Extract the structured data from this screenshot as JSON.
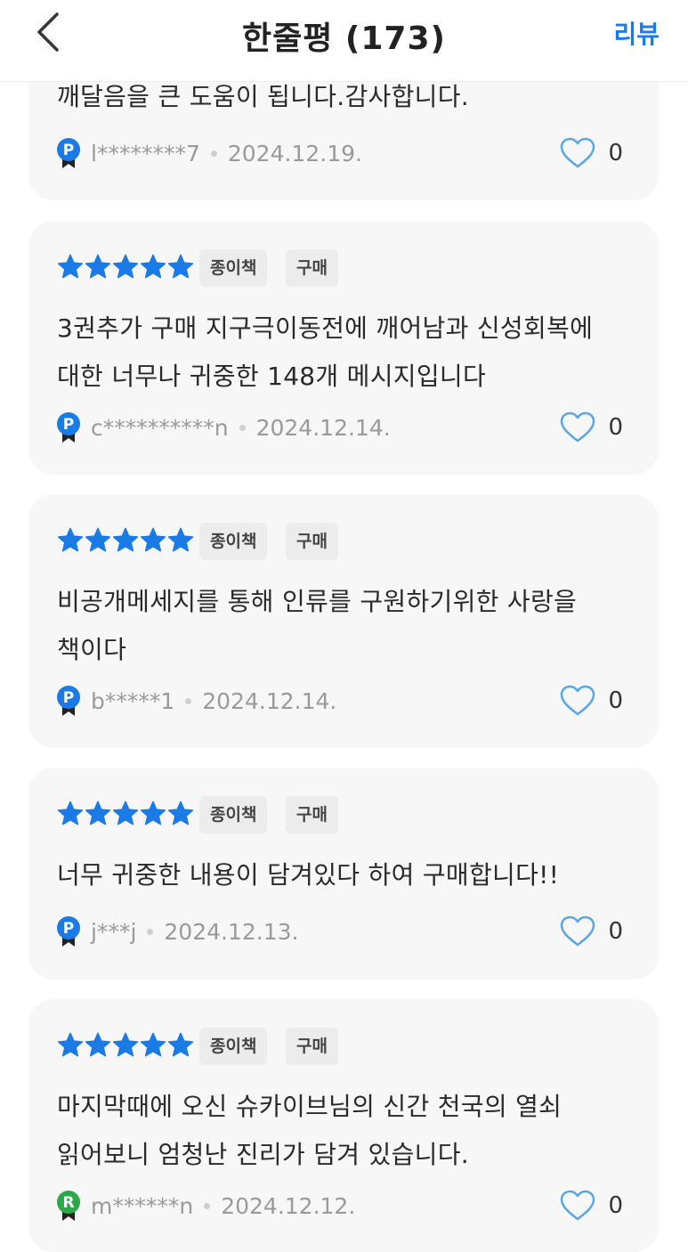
{
  "header": {
    "title": "한줄평 (173)",
    "review_link": "리뷰",
    "accent_color": "#1a7be6"
  },
  "reviews": [
    {
      "text": "깨달음을 큰 도움이 됩니다.감사합니다.",
      "user": "l********7",
      "date": "2024.12.19.",
      "likes": "0",
      "badge": "P"
    },
    {
      "rating": 5,
      "tags": [
        "종이책",
        "구매"
      ],
      "text": "3권추가 구매 지구극이동전에 깨어남과 신성회복에 대한 너무나 귀중한 148개 메시지입니다",
      "user": "c**********n",
      "date": "2024.12.14.",
      "likes": "0",
      "badge": "P"
    },
    {
      "rating": 5,
      "tags": [
        "종이책",
        "구매"
      ],
      "text": "비공개메세지를 통해 인류를 구원하기위한 사랑을 책이다",
      "user": "b*****1",
      "date": "2024.12.14.",
      "likes": "0",
      "badge": "P"
    },
    {
      "rating": 5,
      "tags": [
        "종이책",
        "구매"
      ],
      "text": "너무 귀중한 내용이 담겨있다 하여 구매합니다!!",
      "user": "j***j",
      "date": "2024.12.13.",
      "likes": "0",
      "badge": "P"
    },
    {
      "rating": 5,
      "tags": [
        "종이책",
        "구매"
      ],
      "text": "마지막때에 오신 슈카이브님의 신간 천국의 열쇠 읽어보니 엄청난 진리가 담겨 있습니다.",
      "user": "m******n",
      "date": "2024.12.12.",
      "likes": "0",
      "badge": "R"
    }
  ],
  "colors": {
    "star": "#1a7be6",
    "badge_p": "#1a7be6",
    "badge_r": "#2ba84a",
    "heart": "#5aa7e6"
  },
  "icons": {
    "back": "chevron-left-icon",
    "star": "star-icon",
    "heart": "heart-icon",
    "badge": "grade-badge-icon"
  }
}
